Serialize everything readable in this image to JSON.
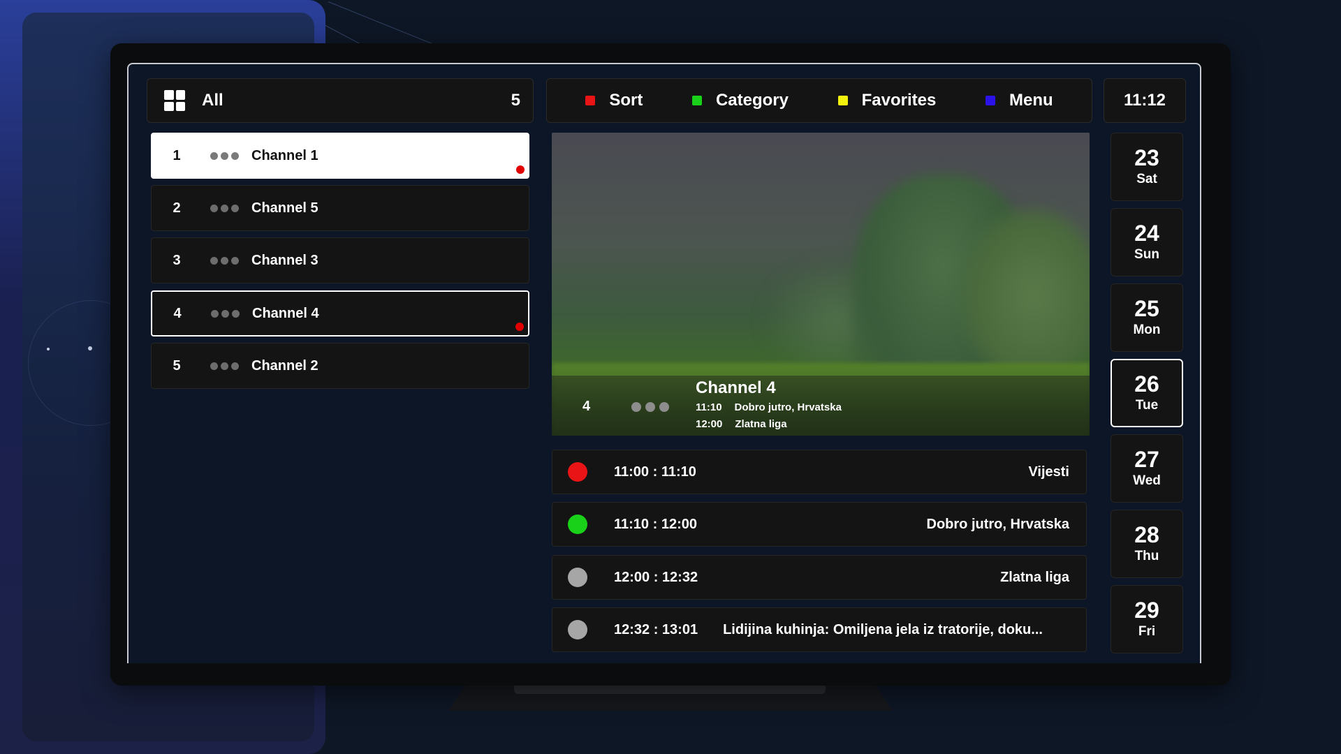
{
  "header": {
    "filter_label": "All",
    "channel_count": "5",
    "keys": [
      {
        "label": "Sort",
        "color": "#e81416"
      },
      {
        "label": "Category",
        "color": "#19d119"
      },
      {
        "label": "Favorites",
        "color": "#f2f20c"
      },
      {
        "label": "Menu",
        "color": "#2a12e8"
      }
    ],
    "clock": "11:12"
  },
  "channels": [
    {
      "number": "1",
      "name": "Channel 1",
      "selected": true,
      "recording": true
    },
    {
      "number": "2",
      "name": "Channel 5",
      "selected": false,
      "recording": false
    },
    {
      "number": "3",
      "name": "Channel 3",
      "selected": false,
      "recording": false
    },
    {
      "number": "4",
      "name": "Channel 4",
      "focused": true,
      "recording": true
    },
    {
      "number": "5",
      "name": "Channel 2",
      "selected": false,
      "recording": false
    }
  ],
  "preview": {
    "channel_number": "4",
    "channel_name": "Channel 4",
    "now": {
      "time": "11:10",
      "title": "Dobro jutro, Hrvatska"
    },
    "next": {
      "time": "12:00",
      "title": "Zlatna liga"
    }
  },
  "schedule": [
    {
      "time": "11:00 : 11:10",
      "title": "Vijesti",
      "status_color": "#e81416"
    },
    {
      "time": "11:10 : 12:00",
      "title": "Dobro jutro, Hrvatska",
      "status_color": "#19d119"
    },
    {
      "time": "12:00 : 12:32",
      "title": "Zlatna liga",
      "status_color": "#a6a6a6"
    },
    {
      "time": "12:32 : 13:01",
      "title": "Lidijina kuhinja: Omiljena jela iz tratorije, doku...",
      "status_color": "#a6a6a6"
    }
  ],
  "dates": [
    {
      "day": "23",
      "weekday": "Sat"
    },
    {
      "day": "24",
      "weekday": "Sun"
    },
    {
      "day": "25",
      "weekday": "Mon"
    },
    {
      "day": "26",
      "weekday": "Tue",
      "selected": true
    },
    {
      "day": "27",
      "weekday": "Wed"
    },
    {
      "day": "28",
      "weekday": "Thu"
    },
    {
      "day": "29",
      "weekday": "Fri"
    }
  ]
}
